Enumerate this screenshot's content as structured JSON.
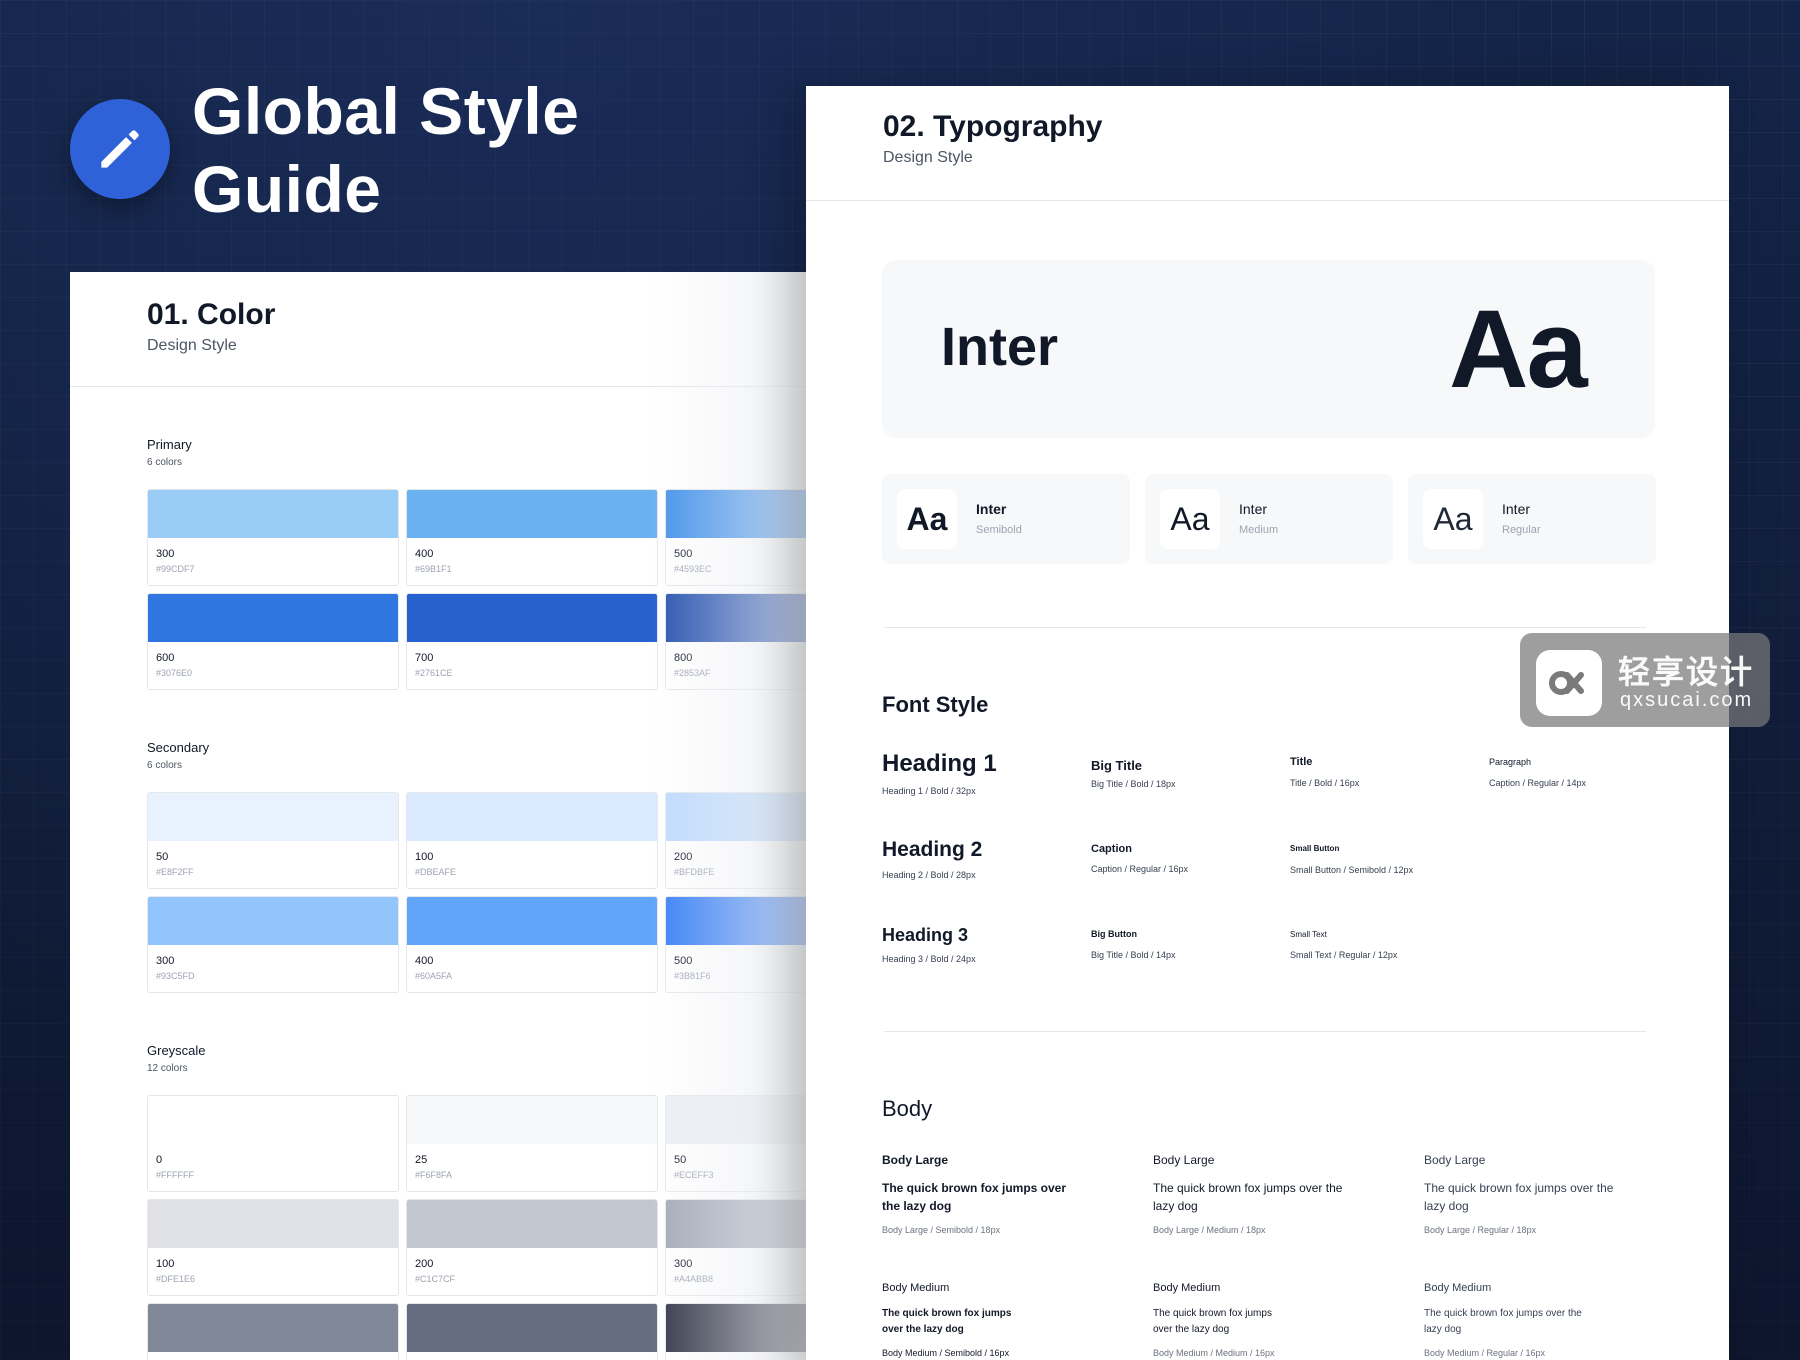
{
  "hero": {
    "title": "Global Style Guide",
    "icon": "pencil-icon",
    "badge_color": "#2F62D8"
  },
  "color_panel": {
    "section_title": "01. Color",
    "subtitle": "Design Style",
    "groups": [
      {
        "name": "Primary",
        "count": "6 colors",
        "swatches": [
          {
            "name": "300",
            "hex": "#99CDF7"
          },
          {
            "name": "400",
            "hex": "#69B1F1"
          },
          {
            "name": "500",
            "hex": "#4593EC"
          },
          {
            "name": "600",
            "hex": "#3076E0"
          },
          {
            "name": "700",
            "hex": "#2761CE"
          },
          {
            "name": "800",
            "hex": "#2853AF"
          }
        ]
      },
      {
        "name": "Secondary",
        "count": "6 colors",
        "swatches": [
          {
            "name": "50",
            "hex": "#E8F2FF"
          },
          {
            "name": "100",
            "hex": "#DBEAFE"
          },
          {
            "name": "200",
            "hex": "#BFDBFE"
          },
          {
            "name": "300",
            "hex": "#93C5FD"
          },
          {
            "name": "400",
            "hex": "#60A5FA"
          },
          {
            "name": "500",
            "hex": "#3B81F6"
          }
        ]
      },
      {
        "name": "Greyscale",
        "count": "12 colors",
        "swatches": [
          {
            "name": "0",
            "hex": "#FFFFFF"
          },
          {
            "name": "25",
            "hex": "#F6F8FA"
          },
          {
            "name": "50",
            "hex": "#ECEFF3"
          },
          {
            "name": "100",
            "hex": "#DFE1E6"
          },
          {
            "name": "200",
            "hex": "#C1C7CF"
          },
          {
            "name": "300",
            "hex": "#A4ABB8"
          },
          {
            "name": "",
            "hex": "",
            "chip": "#808897"
          },
          {
            "name": "",
            "hex": "",
            "chip": "#666D80"
          },
          {
            "name": "",
            "hex": "",
            "chip": "#353849"
          }
        ]
      }
    ]
  },
  "typography_panel": {
    "section_title": "02. Typography",
    "subtitle": "Design Style",
    "font_family": "Inter",
    "font_sample": "Aa",
    "weights": [
      {
        "sample": "Aa",
        "family": "Inter",
        "weight": "Semibold"
      },
      {
        "sample": "Aa",
        "family": "Inter",
        "weight": "Medium"
      },
      {
        "sample": "Aa",
        "family": "Inter",
        "weight": "Regular"
      }
    ],
    "font_style_title": "Font Style",
    "font_styles": [
      {
        "name": "Heading 1",
        "desc": "Heading 1 / Bold / 32px"
      },
      {
        "name": "Big Title",
        "desc": "Big Title / Bold / 18px"
      },
      {
        "name": "Title",
        "desc": "Title / Bold / 16px"
      },
      {
        "name": "Paragraph",
        "desc": "Caption / Regular / 14px"
      },
      {
        "name": "Heading 2",
        "desc": "Heading 2 / Bold / 28px"
      },
      {
        "name": "Caption",
        "desc": "Caption / Regular / 16px"
      },
      {
        "name": "Small Button",
        "desc": "Small Button / Semibold / 12px"
      },
      {
        "name": "Heading 3",
        "desc": "Heading 3 / Bold / 24px"
      },
      {
        "name": "Big Button",
        "desc": "Big Title / Bold / 14px"
      },
      {
        "name": "Small Text",
        "desc": "Small Text / Regular / 12px"
      }
    ],
    "body_title": "Body",
    "body_styles": [
      {
        "label": "Body Large",
        "text": "The quick brown fox jumps over the lazy dog",
        "desc": "Body Large / Semibold / 18px"
      },
      {
        "label": "Body Large",
        "text": "The quick brown fox jumps over the lazy dog",
        "desc": "Body Large / Medium / 18px"
      },
      {
        "label": "Body Large",
        "text": "The quick brown fox jumps over the lazy dog",
        "desc": "Body Large / Regular / 18px"
      },
      {
        "label": "Body Medium",
        "text": "The quick brown fox jumps over the lazy dog",
        "desc": "Body Medium / Semibold / 16px"
      },
      {
        "label": "Body Medium",
        "text": "The quick brown fox jumps over the lazy dog",
        "desc": "Body Medium / Medium / 16px"
      },
      {
        "label": "Body Medium",
        "text": "The quick brown fox jumps over the lazy dog",
        "desc": "Body Medium / Regular / 16px"
      }
    ]
  },
  "watermark": {
    "cn": "轻享设计",
    "en": "qxsucai.com",
    "icon": "watermark-logo-icon"
  }
}
